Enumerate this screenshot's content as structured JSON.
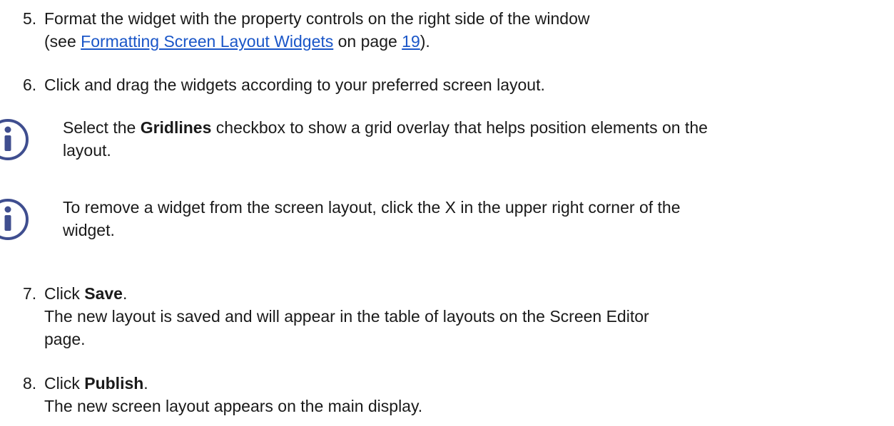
{
  "steps": [
    {
      "number": "5.",
      "line1": "Format the widget with the property controls on the right side of the window",
      "line2_before": "(see ",
      "line2_link": "Formatting Screen Layout Widgets",
      "line2_middle": " on page ",
      "line2_page_link": "19",
      "line2_after": ")."
    },
    {
      "number": "6.",
      "line1": "Click and drag the widgets according to your preferred screen layout."
    },
    {
      "number": "7.",
      "line1_before": "Click ",
      "line1_bold": "Save",
      "line1_after": ".",
      "line2": "The new layout is saved and will appear in the table of layouts on the Screen Editor",
      "line3": "page."
    },
    {
      "number": "8.",
      "line1_before": "Click ",
      "line1_bold": "Publish",
      "line1_after": ".",
      "line2": "The new screen layout appears on the main display."
    }
  ],
  "notes": [
    {
      "icon": "info-icon",
      "line1_before": "Select the ",
      "line1_bold": "Gridlines",
      "line1_after": " checkbox to show a grid overlay that helps position elements on the",
      "line2": "layout."
    },
    {
      "icon": "info-icon",
      "line1": "To remove a widget from the screen layout, click the X in the upper right corner of the",
      "line2": "widget."
    }
  ],
  "colors": {
    "text": "#1a1a1a",
    "link": "#1a56c8",
    "icon": "#3f4e8f"
  }
}
